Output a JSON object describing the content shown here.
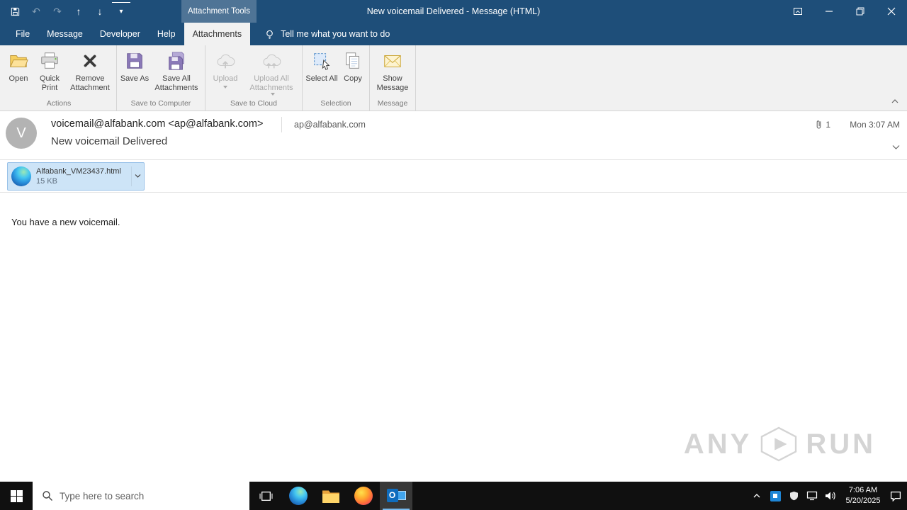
{
  "titlebar": {
    "contextual_group": "Attachment Tools",
    "title": "New voicemail Delivered  -  Message (HTML)"
  },
  "tabs": {
    "file": "File",
    "message": "Message",
    "developer": "Developer",
    "help": "Help",
    "attachments": "Attachments",
    "tell_me": "Tell me what you want to do"
  },
  "ribbon": {
    "actions": {
      "label": "Actions",
      "open": "Open",
      "quick_print": "Quick Print",
      "remove_attachment": "Remove Attachment"
    },
    "save_to_computer": {
      "label": "Save to Computer",
      "save_as": "Save As",
      "save_all": "Save All Attachments"
    },
    "save_to_cloud": {
      "label": "Save to Cloud",
      "upload": "Upload",
      "upload_all": "Upload All Attachments"
    },
    "selection": {
      "label": "Selection",
      "select_all": "Select All",
      "copy": "Copy"
    },
    "message_group": {
      "label": "Message",
      "show_message": "Show Message"
    }
  },
  "header": {
    "avatar_initial": "V",
    "from": "voicemail@alfabank.com <ap@alfabank.com>",
    "to": "ap@alfabank.com",
    "attachment_count": "1",
    "received": "Mon 3:07 AM",
    "subject": "New voicemail Delivered"
  },
  "attachment": {
    "filename": "Alfabank_VM23437.html",
    "size": "15 KB"
  },
  "body": {
    "text": "You have a new voicemail."
  },
  "watermark": {
    "left": "ANY",
    "right": "RUN"
  },
  "taskbar": {
    "search_placeholder": "Type here to search",
    "time": "7:06 AM",
    "date": "5/20/2025"
  },
  "icons": {
    "undo": "↶",
    "redo": "↷",
    "previous": "↑",
    "next": "↓",
    "qat_dropdown": "▾",
    "outlook_letter": "O"
  },
  "colors": {
    "titlebar_blue": "#1e4e79",
    "ribbon_gray": "#f1f1f1",
    "attachment_selected": "#cde4f7",
    "taskbar_black": "#101010"
  }
}
